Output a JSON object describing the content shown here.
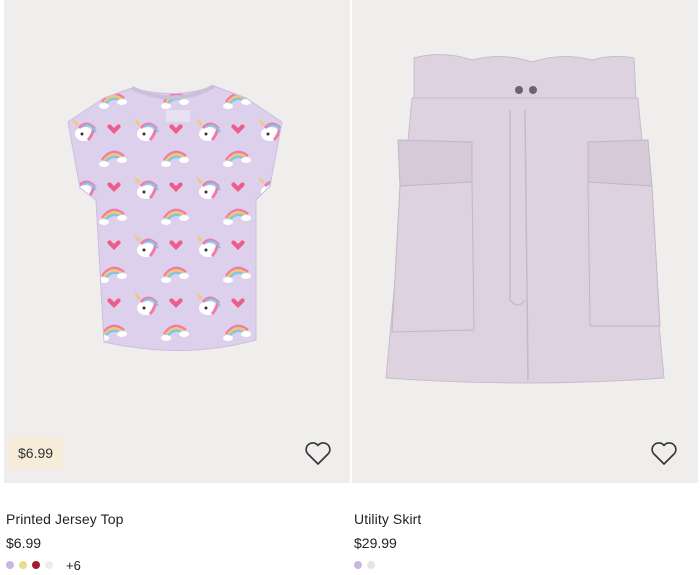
{
  "products": [
    {
      "name": "Printed Jersey Top",
      "price": "$6.99",
      "price_tag": "$6.99",
      "favorite_icon": "heart-outline-icon",
      "swatches": [
        {
          "color": "#c9b6e4",
          "name": "light purple"
        },
        {
          "color": "#e9dc8a",
          "name": "light yellow"
        },
        {
          "color": "#a11c2c",
          "name": "dark red"
        },
        {
          "color": "#ececec",
          "name": "white"
        }
      ],
      "more_colors": "+6"
    },
    {
      "name": "Utility Skirt",
      "price": "$29.99",
      "favorite_icon": "heart-outline-icon",
      "swatches": [
        {
          "color": "#c9b6e4",
          "name": "light purple"
        },
        {
          "color": "#e8e4e2",
          "name": "light beige"
        }
      ]
    }
  ],
  "colors": {
    "background": "#ffffff",
    "image_bg": "#efeeec",
    "price_tag_bg": "#f6ecd9",
    "tshirt": "#ddd0ec",
    "skirt": "#ddd2e0"
  }
}
